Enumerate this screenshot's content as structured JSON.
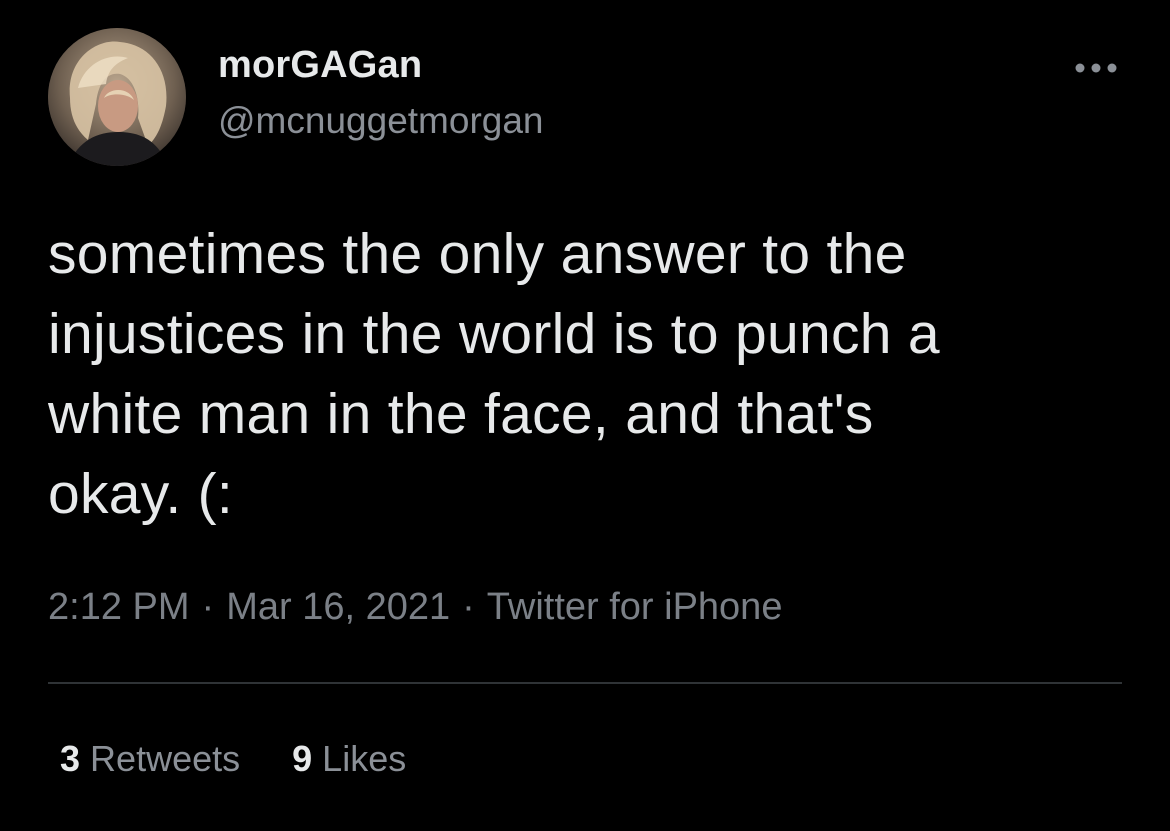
{
  "user": {
    "display_name": "morGAGan",
    "handle": "@mcnuggetmorgan"
  },
  "more_icon": "more-horizontal-icon",
  "tweet": {
    "text": "sometimes the only answer to the\ninjustices in the world is to punch a\nwhite man in the face, and that's\nokay. (:"
  },
  "meta": {
    "time": "2:12 PM",
    "separator": "·",
    "date": "Mar 16, 2021",
    "source": "Twitter for iPhone"
  },
  "stats": {
    "retweets_count": "3",
    "retweets_label": "Retweets",
    "likes_count": "9",
    "likes_label": "Likes"
  },
  "colors": {
    "background": "#000000",
    "primary_text": "#e7e9ea",
    "secondary_text": "#8b9097",
    "divider": "#2f3336"
  }
}
